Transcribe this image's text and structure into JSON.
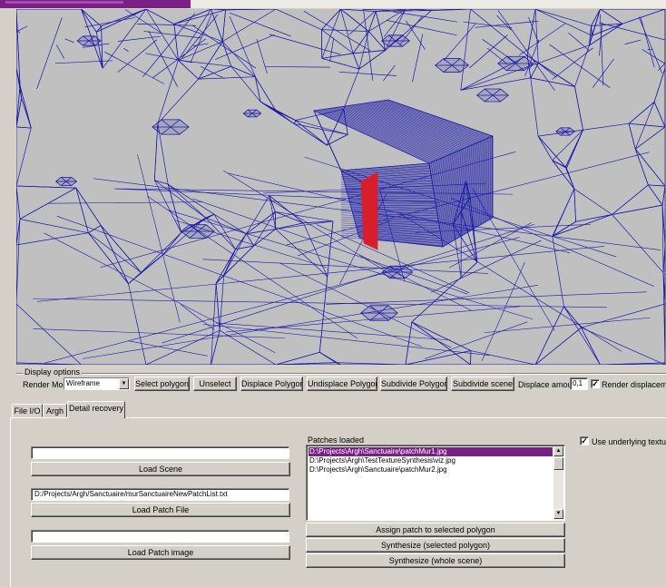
{
  "display_options": {
    "group_label": "Display options",
    "render_mode_label": "Render Mode",
    "render_mode_value": "Wireframe",
    "buttons": {
      "select_polygon": "Select polygon",
      "unselect": "Unselect",
      "displace_polygon": "Displace Polygon",
      "undisplace_polygon": "Undisplace Polygon",
      "subdivide_polygon": "Subdivide Polygon",
      "subdivide_scene": "Subdivide scene"
    },
    "displace_amount_label": "Displace amount:",
    "displace_amount_value": "0,1",
    "render_displacement_label": "Render displacement",
    "render_displacement_checked": true
  },
  "tabs": [
    {
      "label": "File I/O",
      "active": false
    },
    {
      "label": "Argh",
      "active": false
    },
    {
      "label": "Detail recovery",
      "active": true
    }
  ],
  "detail": {
    "scene_path": "",
    "load_scene": "Load Scene",
    "patch_file_path": "D:/Projects/Argh/Sanctuaire/murSanctuaireNewPatchList.txt",
    "load_patch_file": "Load Patch File",
    "patch_image_path": "",
    "load_patch_image": "Load Patch image",
    "patches_loaded_label": "Patches loaded",
    "patches": [
      "D:\\Projects\\Argh\\Sanctuaire\\patchMur1.jpg",
      "D:\\Projects\\Argh\\TestTextureSynthesis\\viz.jpg",
      "D:\\Projects\\Argh\\Sanctuaire\\patchMur2.jpg"
    ],
    "selected_patch_index": 0,
    "assign_patch": "Assign patch to selected polygon",
    "synthesize_selected": "Synthesize (selected polygon)",
    "synthesize_whole": "Synthesize (whole scene)",
    "use_underlying_texture_label": "Use underlying texture",
    "use_underlying_texture_checked": true
  },
  "colors": {
    "wire": "#1a1aa8",
    "selected_face": "#d81e2a",
    "accent": "#7a1f86"
  }
}
